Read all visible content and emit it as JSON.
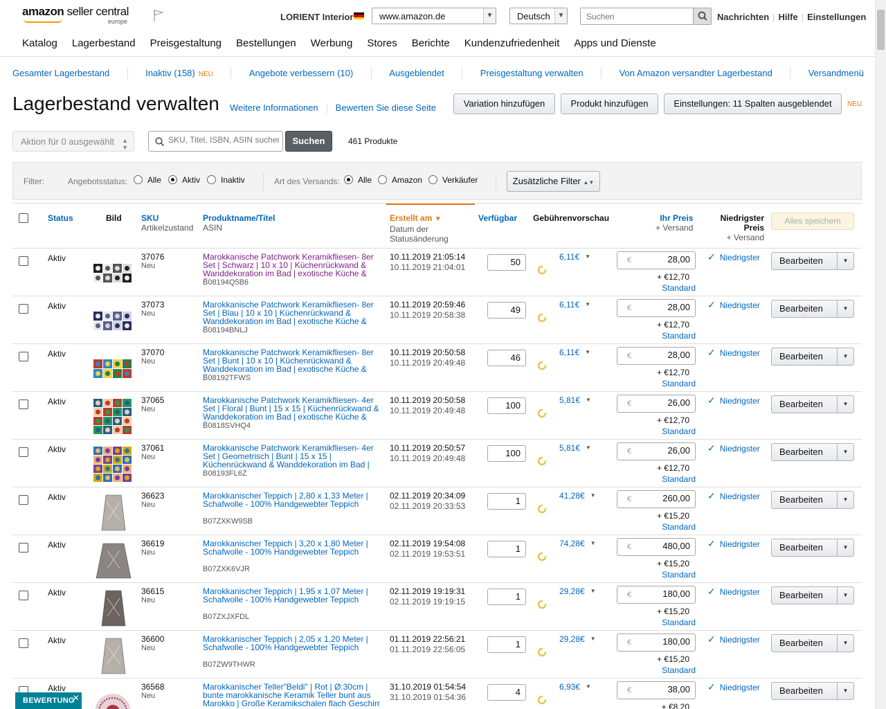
{
  "header": {
    "logo_text_bold": "amazon",
    "logo_text": " seller central",
    "logo_region": "europe",
    "store_name": "LORIENT Interior",
    "marketplace": "www.amazon.de",
    "language": "Deutsch",
    "search_placeholder": "Suchen",
    "links": [
      "Nachrichten",
      "Hilfe",
      "Einstellungen"
    ]
  },
  "main_nav": [
    "Katalog",
    "Lagerbestand",
    "Preisgestaltung",
    "Bestellungen",
    "Werbung",
    "Stores",
    "Berichte",
    "Kundenzufriedenheit",
    "Apps und Dienste"
  ],
  "sub_nav": [
    {
      "label": "Gesamter Lagerbestand",
      "badge": ""
    },
    {
      "label": "Inaktiv (158)",
      "badge": "NEU"
    },
    {
      "label": "Angebote verbessern (10)",
      "badge": ""
    },
    {
      "label": "Ausgeblendet",
      "badge": ""
    },
    {
      "label": "Preisgestaltung verwalten",
      "badge": ""
    },
    {
      "label": "Von Amazon versandter Lagerbestand",
      "badge": ""
    },
    {
      "label": "Versandmenü",
      "badge": ""
    }
  ],
  "page": {
    "title": "Lagerbestand verwalten",
    "more_info": "Weitere Informationen",
    "rate_page": "Bewerten Sie diese Seite",
    "btn_variation": "Variation hinzufügen",
    "btn_add_product": "Produkt hinzufügen",
    "btn_settings": "Einstellungen: 11 Spalten ausgeblendet",
    "settings_badge": "NEU"
  },
  "actions": {
    "bulk_action": "Aktion für 0 ausgewählt",
    "search_placeholder": "SKU, Titel, ISBN, ASIN suchen",
    "search_button": "Suchen",
    "product_count": "461 Produkte"
  },
  "filters": {
    "label": "Filter:",
    "offer_status_label": "Angebotsstatus:",
    "offer_status_options": [
      "Alle",
      "Aktiv",
      "Inaktiv"
    ],
    "offer_status_selected": "Aktiv",
    "shipping_label": "Art des Versands:",
    "shipping_options": [
      "Alle",
      "Amazon",
      "Verkäufer"
    ],
    "shipping_selected": "Alle",
    "more_filters": "Zusätzliche Filter"
  },
  "table": {
    "headers": {
      "status": "Status",
      "image": "Bild",
      "sku": "SKU",
      "sku_sub": "Artikelzustand",
      "name": "Produktname/Titel",
      "name_sub": "ASIN",
      "created": "Erstellt am",
      "created_sub1": "Datum der",
      "created_sub2": "Statusänderung",
      "available": "Verfügbar",
      "fees": "Gebührenvorschau",
      "price": "Ihr Preis",
      "price_sub": "+ Versand",
      "lowest1": "Niedrigster",
      "lowest2": "Preis",
      "lowest_sub": "+ Versand",
      "save_all": "Alles speichern"
    },
    "rows": [
      {
        "status": "Aktiv",
        "sku": "37076",
        "cond": "Neu",
        "title": "Marokkanische Patchwork Keramikfliesen- 8er Set | Schwarz | 10 x 10 | Küchenrückwand & Wanddekoration im Bad | exotische Küche & Flur",
        "visited": true,
        "asin": "B08194Q5B6",
        "date1": "10.11.2019 21:05:14",
        "date2": "10.11.2019 21:04:01",
        "avail": "50",
        "fee": "6,11€",
        "price": "28,00",
        "ship": "+ €12,70",
        "std": "Standard",
        "lowest": "Niedrigster",
        "edit": "Bearbeiten",
        "thumb": "tiles-bw"
      },
      {
        "status": "Aktiv",
        "sku": "37073",
        "cond": "Neu",
        "title": "Marokkanische Patchwork Keramikfliesen- 8er Set | Blau | 10 x 10 | Küchenrückwand & Wanddekoration im Bad | exotische Küche & Flur",
        "visited": false,
        "asin": "B08194BNLJ",
        "date1": "10.11.2019 20:59:46",
        "date2": "10.11.2019 20:58:38",
        "avail": "49",
        "fee": "6,11€",
        "price": "28,00",
        "ship": "+ €12,70",
        "std": "Standard",
        "lowest": "Niedrigster",
        "edit": "Bearbeiten",
        "thumb": "tiles-blue"
      },
      {
        "status": "Aktiv",
        "sku": "37070",
        "cond": "Neu",
        "title": "Marokkanische Patchwork Keramikfliesen- 8er Set | Bunt | 10 x 10 | Küchenrückwand & Wanddekoration im Bad | exotische Küche & Flur",
        "visited": false,
        "asin": "B08192TFWS",
        "date1": "10.11.2019 20:50:58",
        "date2": "10.11.2019 20:49:48",
        "avail": "46",
        "fee": "6,11€",
        "price": "28,00",
        "ship": "+ €12,70",
        "std": "Standard",
        "lowest": "Niedrigster",
        "edit": "Bearbeiten",
        "thumb": "tiles-color"
      },
      {
        "status": "Aktiv",
        "sku": "37065",
        "cond": "Neu",
        "title": "Marokkanische Patchwork Keramikfliesen- 4er Set | Floral | Bunt | 15 x 15 | Küchenrückwand & Wanddekoration im Bad | exotische Küche & Flur",
        "visited": false,
        "asin": "B0818SVHQ4",
        "date1": "10.11.2019 20:50:58",
        "date2": "10.11.2019 20:49:48",
        "avail": "100",
        "fee": "5,81€",
        "price": "26,00",
        "ship": "+ €12,70",
        "std": "Standard",
        "lowest": "Niedrigster",
        "edit": "Bearbeiten",
        "thumb": "tiles-floral"
      },
      {
        "status": "Aktiv",
        "sku": "37061",
        "cond": "Neu",
        "title": "Marokkanische Patchwork Keramikfliesen- 4er Set | Geometrisch | Bunt | 15 x 15 | Küchenrückwand & Wanddekoration im Bad | exotische Küche",
        "visited": false,
        "asin": "B08193FL6Z",
        "date1": "10.11.2019 20:50:57",
        "date2": "10.11.2019 20:49:48",
        "avail": "100",
        "fee": "5,81€",
        "price": "26,00",
        "ship": "+ €12,70",
        "std": "Standard",
        "lowest": "Niedrigster",
        "edit": "Bearbeiten",
        "thumb": "tiles-geo"
      },
      {
        "status": "Aktiv",
        "sku": "36623",
        "cond": "Neu",
        "title": "Marokkanischer Teppich | 2,80 x 1,33 Meter | Schafwolle - 100% Handgewebter Teppich",
        "visited": false,
        "asin": "B07ZXKW9SB",
        "date1": "02.11.2019 20:34:09",
        "date2": "02.11.2019 20:33:53",
        "avail": "1",
        "fee": "41,28€",
        "price": "260,00",
        "ship": "+ €15,20",
        "std": "Standard",
        "lowest": "Niedrigster",
        "edit": "Bearbeiten",
        "thumb": "rug-light"
      },
      {
        "status": "Aktiv",
        "sku": "36619",
        "cond": "Neu",
        "title": "Marokkanischer Teppich | 3,20 x 1,80 Meter | Schafwolle - 100% Handgewebter Teppich",
        "visited": false,
        "asin": "B07ZXK6VJR",
        "date1": "02.11.2019 19:54:08",
        "date2": "02.11.2019 19:53:51",
        "avail": "1",
        "fee": "74,28€",
        "price": "480,00",
        "ship": "+ €15,20",
        "std": "Standard",
        "lowest": "Niedrigster",
        "edit": "Bearbeiten",
        "thumb": "rug-wide"
      },
      {
        "status": "Aktiv",
        "sku": "36615",
        "cond": "Neu",
        "title": "Marokkanischer Teppich | 1,95 x 1,07 Meter | Schafwolle - 100% Handgewebter Teppich",
        "visited": false,
        "asin": "B07ZXJXFDL",
        "date1": "02.11.2019 19:19:31",
        "date2": "02.11.2019 19:19:15",
        "avail": "1",
        "fee": "29,28€",
        "price": "180,00",
        "ship": "+ €15,20",
        "std": "Standard",
        "lowest": "Niedrigster",
        "edit": "Bearbeiten",
        "thumb": "rug-dark"
      },
      {
        "status": "Aktiv",
        "sku": "36600",
        "cond": "Neu",
        "title": "Marokkanischer Teppich | 2,05 x 1,20 Meter | Schafwolle - 100% Handgewebter Teppich",
        "visited": false,
        "asin": "B07ZW9THWR",
        "date1": "01.11.2019 22:56:21",
        "date2": "01.11.2019 22:56:05",
        "avail": "1",
        "fee": "29,28€",
        "price": "180,00",
        "ship": "+ €15,20",
        "std": "Standard",
        "lowest": "Niedrigster",
        "edit": "Bearbeiten",
        "thumb": "rug-light"
      },
      {
        "status": "Aktiv",
        "sku": "36568",
        "cond": "Neu",
        "title": "Marokkanischer Teller\"Beldi\" | Rot | Ø:30cm | bunte marokkanische Keramik Teller bunt aus Marokko | Große Keramikschalen flach Geschirr aus",
        "visited": false,
        "asin": "",
        "date1": "31.10.2019 01:54:54",
        "date2": "31.10.2019 01:54:36",
        "avail": "4",
        "fee": "6,93€",
        "price": "38,00",
        "ship": "+ €8,20",
        "std": "Standard",
        "lowest": "Niedrigster",
        "edit": "Bearbeiten",
        "thumb": "plate"
      }
    ]
  },
  "feedback_badge": "BEWERTUNG",
  "colors": {
    "link": "#0066c0",
    "accent_orange": "#e47911",
    "visited": "#7f1f8a",
    "check_green": "#067d62",
    "feedback_teal": "#008296"
  }
}
